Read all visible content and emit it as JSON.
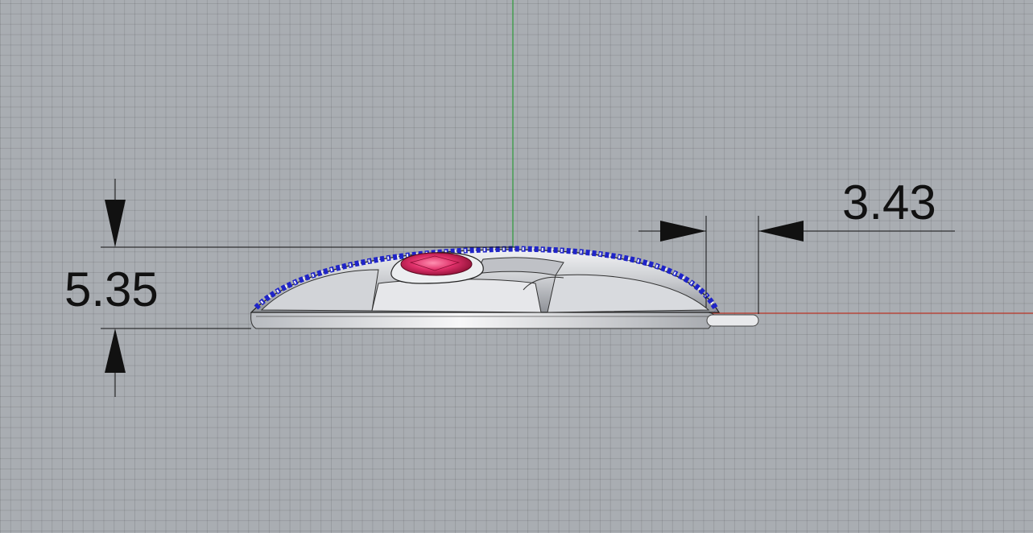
{
  "viewport": {
    "title": "",
    "background_color": "#a9adb2",
    "x_axis_color": "#c0392b",
    "y_axis_color": "#2e9b3a"
  },
  "dimensions": {
    "vertical": {
      "value": "5.35",
      "orientation": "vertical"
    },
    "horizontal": {
      "value": "3.43",
      "orientation": "horizontal"
    }
  },
  "model": {
    "name": "",
    "metal_color": "#d6d7da",
    "accent_stone_color": "#1f24c8",
    "center_stone_color": "#e0306a"
  }
}
